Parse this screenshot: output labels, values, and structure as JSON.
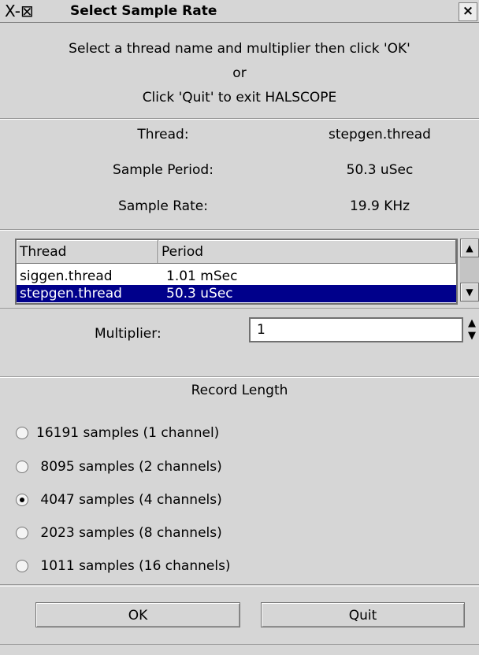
{
  "window": {
    "title": "Select Sample Rate",
    "icons_text": "X-⊠",
    "close_glyph": "×"
  },
  "message": {
    "line1": "Select a thread name and multiplier then click 'OK'",
    "line2": "or",
    "line3": "Click 'Quit' to exit HALSCOPE"
  },
  "info": {
    "thread_label": "Thread:",
    "thread_value": "stepgen.thread",
    "period_label": "Sample Period:",
    "period_value": "50.3 uSec",
    "rate_label": "Sample Rate:",
    "rate_value": "19.9 KHz"
  },
  "thread_list": {
    "headers": [
      "Thread",
      "Period"
    ],
    "rows": [
      {
        "thread": "siggen.thread",
        "period": "1.01 mSec",
        "selected": false
      },
      {
        "thread": "stepgen.thread",
        "period": "50.3 uSec",
        "selected": true
      }
    ]
  },
  "multiplier": {
    "label": "Multiplier:",
    "value": "1"
  },
  "record_length": {
    "heading": "Record Length",
    "options": [
      {
        "label": "16191 samples (1 channel)",
        "checked": false
      },
      {
        "label": " 8095 samples (2 channels)",
        "checked": false
      },
      {
        "label": " 4047 samples (4 channels)",
        "checked": true
      },
      {
        "label": " 2023 samples (8 channels)",
        "checked": false
      },
      {
        "label": " 1011 samples (16 channels)",
        "checked": false
      }
    ]
  },
  "buttons": {
    "ok": "OK",
    "quit": "Quit"
  }
}
